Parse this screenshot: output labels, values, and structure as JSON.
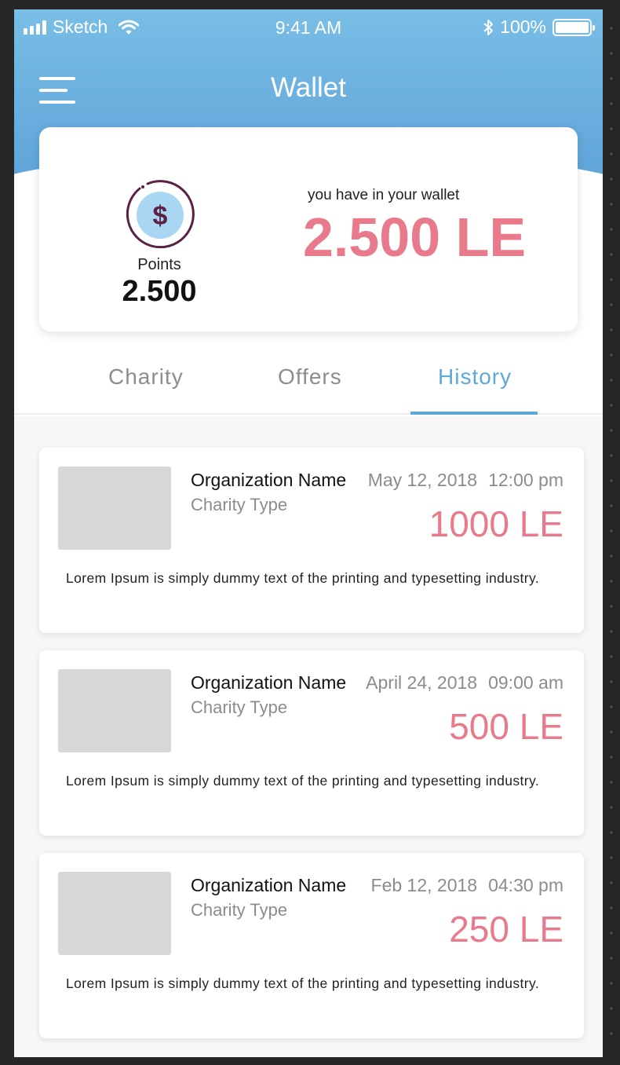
{
  "status_bar": {
    "carrier": "Sketch",
    "time": "9:41 AM",
    "battery": "100%"
  },
  "header": {
    "title": "Wallet"
  },
  "wallet_card": {
    "points_label": "Points",
    "points_value": "2.500",
    "wallet_label": "you have in your wallet",
    "wallet_amount": "2.500 LE"
  },
  "tabs": [
    {
      "label": "Charity",
      "active": false
    },
    {
      "label": "Offers",
      "active": false
    },
    {
      "label": "History",
      "active": true
    }
  ],
  "history": [
    {
      "org_name": "Organization Name",
      "type": "Charity Type",
      "date": "May 12, 2018",
      "time": "12:00 pm",
      "amount": "1000 LE",
      "description": "Lorem Ipsum is simply dummy text of the printing and typesetting industry."
    },
    {
      "org_name": "Organization Name",
      "type": "Charity Type",
      "date": "April 24, 2018",
      "time": "09:00 am",
      "amount": "500 LE",
      "description": "Lorem Ipsum is simply dummy text of the printing and typesetting industry."
    },
    {
      "org_name": "Organization Name",
      "type": "Charity Type",
      "date": "Feb 12, 2018",
      "time": "04:30 pm",
      "amount": "250 LE",
      "description": "Lorem Ipsum is simply dummy text of the printing and typesetting industry."
    }
  ],
  "colors": {
    "header_top": "#78bee6",
    "header_bottom": "#5b9fd6",
    "accent_amount": "#e87a8b",
    "active_tab": "#5aa9d8",
    "coin_ring": "#5b2142",
    "coin_fill": "#a9d6f2"
  },
  "icons": {
    "menu": "hamburger-menu-icon",
    "coin": "dollar-coin-icon",
    "wifi": "wifi-icon",
    "bluetooth": "bluetooth-icon",
    "signal": "signal-icon",
    "battery": "battery-icon"
  }
}
